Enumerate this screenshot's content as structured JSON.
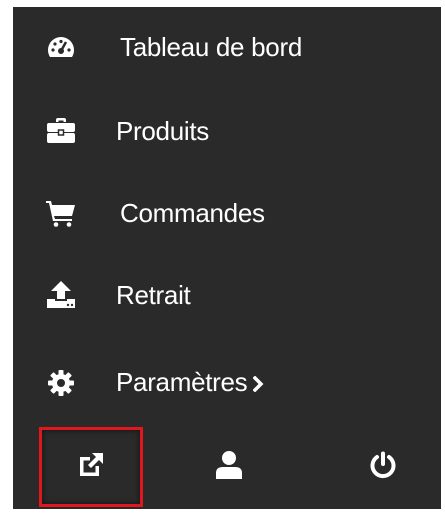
{
  "menu": {
    "items": [
      {
        "label": "Tableau de bord",
        "icon": "dashboard-icon"
      },
      {
        "label": "Produits",
        "icon": "briefcase-icon"
      },
      {
        "label": "Commandes",
        "icon": "shopping-cart-icon"
      },
      {
        "label": "Retrait",
        "icon": "upload-icon"
      },
      {
        "label": "Paramètres",
        "icon": "gear-icon",
        "submenu_indicator": "chevron-right-icon"
      }
    ]
  },
  "bottom_bar": {
    "buttons": [
      {
        "icon": "external-link-icon",
        "highlighted": true
      },
      {
        "icon": "user-icon",
        "highlighted": false
      },
      {
        "icon": "power-icon",
        "highlighted": false
      }
    ]
  },
  "colors": {
    "background": "#2a2a2a",
    "text": "#ffffff",
    "highlight_border": "#e0171f"
  }
}
